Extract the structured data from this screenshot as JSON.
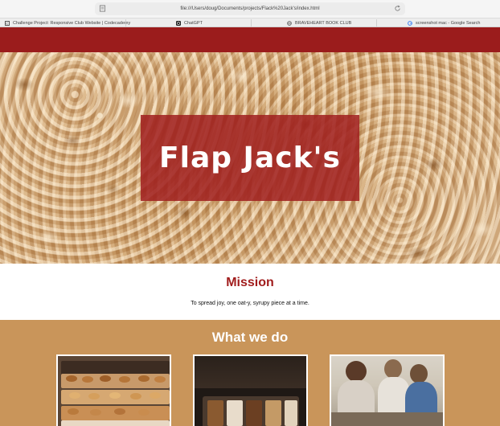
{
  "browser": {
    "url": "file:///Users/doug/Documents/projects/Flack%20Jack's/index.html",
    "bookmarks": [
      {
        "label": "Challenge Project: Responsive Club Website | Codecademy",
        "icon": "codecademy-icon"
      },
      {
        "label": "ChatGPT",
        "icon": "chatgpt-icon"
      },
      {
        "label": "BRAVEHEART BOOK CLUB",
        "icon": "globe-icon"
      },
      {
        "label": "screenshot mac - Google Search",
        "icon": "google-icon"
      }
    ]
  },
  "hero": {
    "title": "Flap Jack's"
  },
  "mission": {
    "title": "Mission",
    "text": "To spread joy, one oat-y, syrupy piece at a time."
  },
  "what_we_do": {
    "title": "What we do",
    "cards": [
      {
        "image": "pastry-display-image"
      },
      {
        "image": "flapjack-bars-image"
      },
      {
        "image": "people-cafe-image"
      }
    ]
  },
  "colors": {
    "brand_red": "#9b1c1c",
    "mission_title": "#a11d1d",
    "section_tan": "#c9955a"
  }
}
